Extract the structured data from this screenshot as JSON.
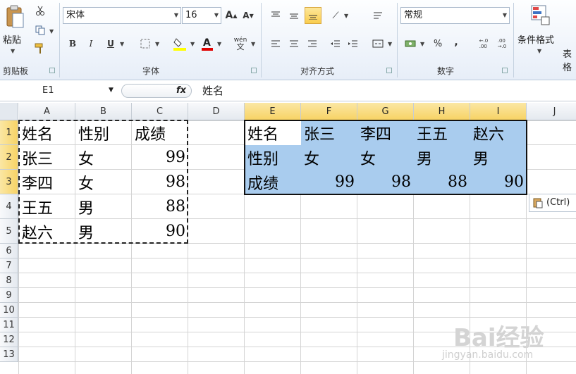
{
  "ribbon": {
    "clipboard": {
      "paste_label": "粘贴",
      "group_label": "剪贴板"
    },
    "font": {
      "font_name": "宋体",
      "font_size": "16",
      "bold": "B",
      "italic": "I",
      "underline": "U",
      "group_label": "字体",
      "grow": "A",
      "shrink": "A",
      "wen": "wén"
    },
    "alignment": {
      "group_label": "对齐方式"
    },
    "number": {
      "format": "常规",
      "percent": "%",
      "comma": ",",
      "group_label": "数字",
      "inc_dec": "+.0\n.00",
      "dec_dec": ".00\n+.0"
    },
    "styles": {
      "conditional_label": "条件格式",
      "table_label": "表格"
    }
  },
  "formula_bar": {
    "name_box": "E1",
    "fx": "fx",
    "content": "姓名"
  },
  "columns": [
    "A",
    "B",
    "C",
    "D",
    "E",
    "F",
    "G",
    "H",
    "I",
    "J"
  ],
  "selected_columns": [
    "E",
    "F",
    "G",
    "H",
    "I"
  ],
  "rows": [
    "1",
    "2",
    "3",
    "4",
    "5",
    "6",
    "7",
    "8",
    "9",
    "10",
    "11",
    "12",
    "13"
  ],
  "selected_rows": [
    "1",
    "2",
    "3"
  ],
  "source_table": [
    [
      "姓名",
      "性别",
      "成绩"
    ],
    [
      "张三",
      "女",
      "99"
    ],
    [
      "李四",
      "女",
      "98"
    ],
    [
      "王五",
      "男",
      "88"
    ],
    [
      "赵六",
      "男",
      "90"
    ]
  ],
  "transposed_table": [
    [
      "姓名",
      "张三",
      "李四",
      "王五",
      "赵六"
    ],
    [
      "性别",
      "女",
      "女",
      "男",
      "男"
    ],
    [
      "成绩",
      "99",
      "98",
      "88",
      "90"
    ]
  ],
  "paste_options": {
    "label": "(Ctrl)"
  },
  "watermark": {
    "text": "Bai经验",
    "url": "jingyan.baidu.com"
  },
  "colors": {
    "selection_fill": "#a9ccee",
    "header_selected": "#f7d365",
    "ribbon_bg": "#e7eef8"
  }
}
